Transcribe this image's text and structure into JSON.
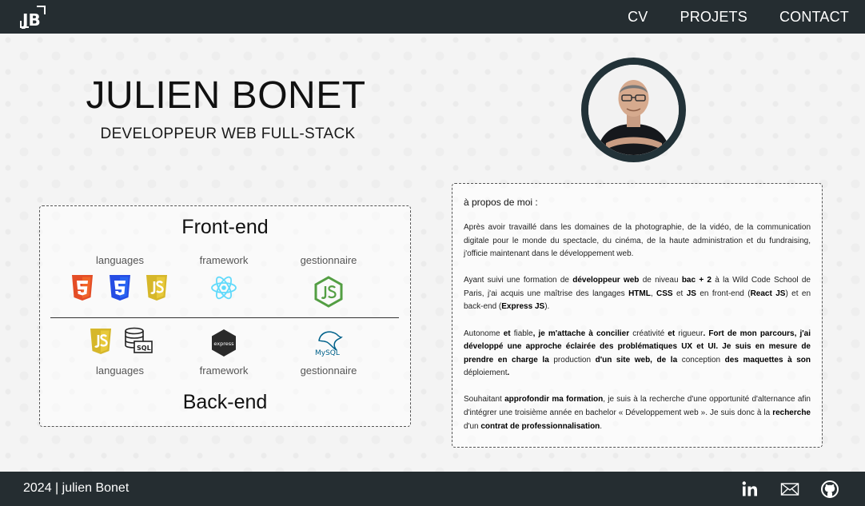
{
  "header": {
    "logo_text": "JB",
    "nav": [
      "CV",
      "PROJETS",
      "CONTACT"
    ]
  },
  "hero": {
    "name": "JULIEN BONET",
    "role": "DEVELOPPEUR WEB FULL-STACK"
  },
  "skills": {
    "front_title": "Front-end",
    "back_title": "Back-end",
    "labels": [
      "languages",
      "framework",
      "gestionnaire"
    ],
    "front_icons": [
      "html5-icon",
      "css3-icon",
      "javascript-icon",
      "react-icon",
      "nodejs-icon"
    ],
    "back_icons": [
      "javascript-icon",
      "sql-icon",
      "express-icon",
      "mysql-icon"
    ],
    "express_text": "express",
    "mysql_text": "MySQL",
    "sql_text": "SQL"
  },
  "about": {
    "title": "à propos de moi :",
    "p1": "Après avoir travaillé dans les domaines de la photographie, de la vidéo, de la communication digitale pour le monde du spectacle, du cinéma, de la haute administration et du fundraising, j'officie maintenant dans le développement web.",
    "p2": [
      "Ayant suivi une formation de ",
      "développeur web",
      " de niveau ",
      "bac + 2",
      " à la Wild Code School de Paris, j'ai acquis une maîtrise des langages ",
      "HTML",
      ", ",
      "CSS",
      " et ",
      "JS",
      " en front-end (",
      "React JS",
      ") et en back-end (",
      "Express JS",
      ")."
    ],
    "p3": [
      "Autonome",
      " et ",
      "fiable",
      ", je m'attache à concilier ",
      "créativité",
      " et ",
      "rigueur",
      ". Fort de mon parcours, j'ai développé une approche éclairée des problématiques UX et UI. Je suis en mesure de prendre en charge la ",
      "production",
      " d'un site web, de la ",
      "conception",
      " des maquettes à son ",
      "déploiement",
      "."
    ],
    "p4": [
      "Souhaitant ",
      "approfondir ma formation",
      ", je suis à la recherche d'une opportunité d'alternance afin d'intégrer une troisième année en bachelor « Développement web ». Je suis donc à la ",
      "recherche",
      " d'un ",
      "contrat de professionnalisation",
      "."
    ]
  },
  "footer": {
    "copyright": "2024 | julien Bonet",
    "social_icons": [
      "linkedin-icon",
      "mail-icon",
      "github-icon"
    ]
  },
  "colors": {
    "dark": "#252d31",
    "html5": "#e44d26",
    "css3": "#264de4",
    "js": "#d6b72a",
    "react": "#61dafb",
    "node": "#539e43",
    "mysql": "#00618a"
  }
}
